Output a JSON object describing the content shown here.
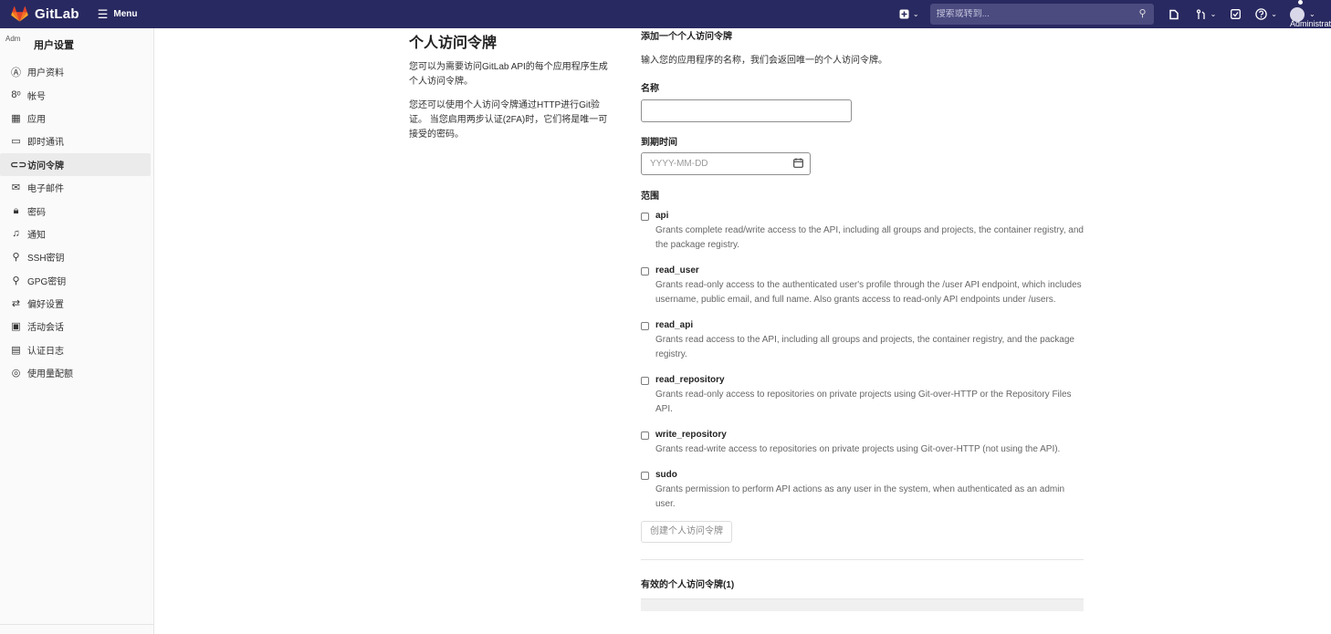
{
  "brand": {
    "name": "GitLab",
    "menu_label": "Menu"
  },
  "navbar": {
    "search_placeholder": "搜索或转到...",
    "user_name": "Administrator"
  },
  "sidebar": {
    "title": "用户设置",
    "avatar_alt": "Adm",
    "items": [
      {
        "label": "用户资料",
        "icon": "profile-icon"
      },
      {
        "label": "帐号",
        "icon": "account-icon"
      },
      {
        "label": "应用",
        "icon": "applications-icon"
      },
      {
        "label": "即时通讯",
        "icon": "chat-icon"
      },
      {
        "label": "访问令牌",
        "icon": "token-icon",
        "active": true
      },
      {
        "label": "电子邮件",
        "icon": "email-icon"
      },
      {
        "label": "密码",
        "icon": "lock-icon"
      },
      {
        "label": "通知",
        "icon": "bell-icon"
      },
      {
        "label": "SSH密钥",
        "icon": "key-icon"
      },
      {
        "label": "GPG密钥",
        "icon": "key-icon"
      },
      {
        "label": "偏好设置",
        "icon": "preferences-icon"
      },
      {
        "label": "活动会话",
        "icon": "monitor-icon"
      },
      {
        "label": "认证日志",
        "icon": "log-icon"
      },
      {
        "label": "使用量配额",
        "icon": "quota-icon"
      }
    ]
  },
  "description": {
    "title": "个人访问令牌",
    "p1": "您可以为需要访问GitLab API的每个应用程序生成个人访问令牌。",
    "p2": "您还可以使用个人访问令牌通过HTTP进行Git验证。 当您启用两步认证(2FA)时，它们将是唯一可接受的密码。"
  },
  "form": {
    "heading": "添加一个个人访问令牌",
    "subtitle": "输入您的应用程序的名称，我们会返回唯一的个人访问令牌。",
    "name_label": "名称",
    "name_value": "",
    "expires_label": "到期时间",
    "expires_placeholder": "YYYY-MM-DD",
    "scopes_label": "范围",
    "scopes": [
      {
        "name": "api",
        "checked": false,
        "desc": "Grants complete read/write access to the API, including all groups and projects, the container registry, and the package registry."
      },
      {
        "name": "read_user",
        "checked": false,
        "desc": "Grants read-only access to the authenticated user's profile through the /user API endpoint, which includes username, public email, and full name. Also grants access to read-only API endpoints under /users."
      },
      {
        "name": "read_api",
        "checked": false,
        "desc": "Grants read access to the API, including all groups and projects, the container registry, and the package registry."
      },
      {
        "name": "read_repository",
        "checked": false,
        "desc": "Grants read-only access to repositories on private projects using Git-over-HTTP or the Repository Files API."
      },
      {
        "name": "write_repository",
        "checked": false,
        "desc": "Grants read-write access to repositories on private projects using Git-over-HTTP (not using the API)."
      },
      {
        "name": "sudo",
        "checked": false,
        "desc": "Grants permission to perform API actions as any user in the system, when authenticated as an admin user."
      }
    ],
    "create_button": "创建个人访问令牌",
    "active_tokens_heading": "有效的个人访问令牌(1)"
  }
}
